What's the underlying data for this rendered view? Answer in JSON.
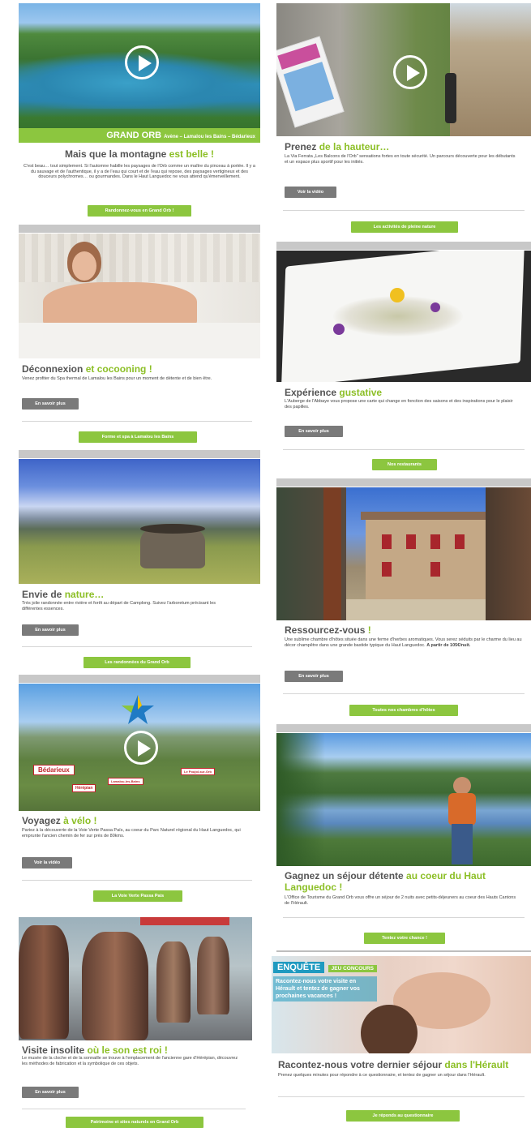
{
  "left": [
    {
      "title_a": "Mais que la montagne",
      "title_b": "est belle !",
      "band_title": "GRAND ORB",
      "band_sub": "Avène – Lamalou les Bains – Bédarieux",
      "body": "C'est beau… tout simplement. Si l'automne habille les paysages de l'Orb comme un maître du pinceau à portée. Il y a du sauvage et de l'authentique, il y a de l'eau qui court et de l'eau qui repose, des paysages vertigineux et des douceurs polychromes… ou gourmandes. Dans le Haut Languedoc ne vous attend qu'émerveillement.",
      "cta": "Randonnez-vous en Grand Orb !"
    },
    {
      "title_a": "Déconnexion",
      "title_b": "et cocooning !",
      "body": "Venez profiter du Spa thermal de Lamalou les Bains pour un moment de détente et de bien être.",
      "more": "En savoir plus",
      "cta": "Forme et spa à Lamalou les Bains"
    },
    {
      "title_a": "Envie de",
      "title_b": "nature…",
      "body": "Très jolie randonnée entre rivière et forêt au départ de Camplong. Suivez l'arboretum précisant les différentes essences.",
      "more": "En savoir plus",
      "cta": "Les randonnées du Grand Orb"
    },
    {
      "title_a": "Voyagez",
      "title_b": "à vélo !",
      "body": "Partez à la découverte de la Voie Verte Passa Païs, au coeur du Parc Naturel régional du Haut Languedoc, qui emprunte l'ancien chemin de fer sur près de 80kms.",
      "more": "Voir la vidéo",
      "cta": "La Voie Verte Passa Pais",
      "map_labels": [
        "Bédarieux",
        "Hérépian",
        "Lamalou-les-Bains",
        "Le Poujol-sur-Orb"
      ]
    },
    {
      "title_a": "Visite insolite",
      "title_b": "où le son est roi !",
      "body": "Le musée de la cloche et de la sonnaille se trouve à l'emplacement de l'ancienne gare d'Hérépian, découvrez les méthodes de fabrication et la symbolique de ces objets.",
      "more": "En savoir plus",
      "cta": "Patrimoine et sites naturels en Grand Orb"
    }
  ],
  "right": [
    {
      "title_a": "Prenez",
      "title_b": "de la hauteur…",
      "body": "La Via Ferrata „Les Balcons de l'Orb\" sensations fortes en toute sécurité. Un parcours découverte pour les débutants et un espace plus sportif pour les initiés.",
      "more": "Voir la vidéo",
      "cta": "Les activités de pleine nature"
    },
    {
      "title_a": "Expérience",
      "title_b": "gustative",
      "body": "L'Auberge de l'Abbaye vous propose une carte qui change en fonction des saisons et des inspirations pour le plaisir des papilles.",
      "more": "En savoir plus",
      "cta": "Nos restaurants"
    },
    {
      "title_a": "Ressourcez-vous",
      "title_b": "!",
      "body": "Une sublime chambre d'hôtes située dans une ferme d'herbes aromatiques. Vous serez séduits par le charme du lieu au décor champêtre dans une grande bastide typique du Haut Languedoc.",
      "body_bold": "A partir de 105€/nuit.",
      "more": "En savoir plus",
      "cta": "Toutes nos chambres d'hôtes"
    },
    {
      "title_a": "Gagnez un séjour détente",
      "title_b": "au coeur du Haut Languedoc !",
      "body": "L'Office de Tourisme du Grand Orb vous offre un séjour de 2 nuits avec petits-déjeuners au coeur des Hauts Cantons de l'Hérault.",
      "cta": "Tentez votre chance !"
    },
    {
      "title_a": "Racontez-nous votre dernier séjour",
      "title_b": "dans l'Hérault",
      "body": "Prenez quelques minutes pour répondre à ce questionnaire, et tentez de gagner un séjour dans l'Hérault.",
      "badge_a": "ENQUÊTE",
      "badge_b": "JEU CONCOURS",
      "badge_c": "Racontez-nous votre visite en Hérault et tentez de gagner vos prochaines vacances !",
      "cta": "Je réponds au questionnaire"
    }
  ],
  "colors": {
    "accent": "#8cc63f",
    "title_grey": "#555555",
    "button_grey": "#7a7a7a"
  }
}
